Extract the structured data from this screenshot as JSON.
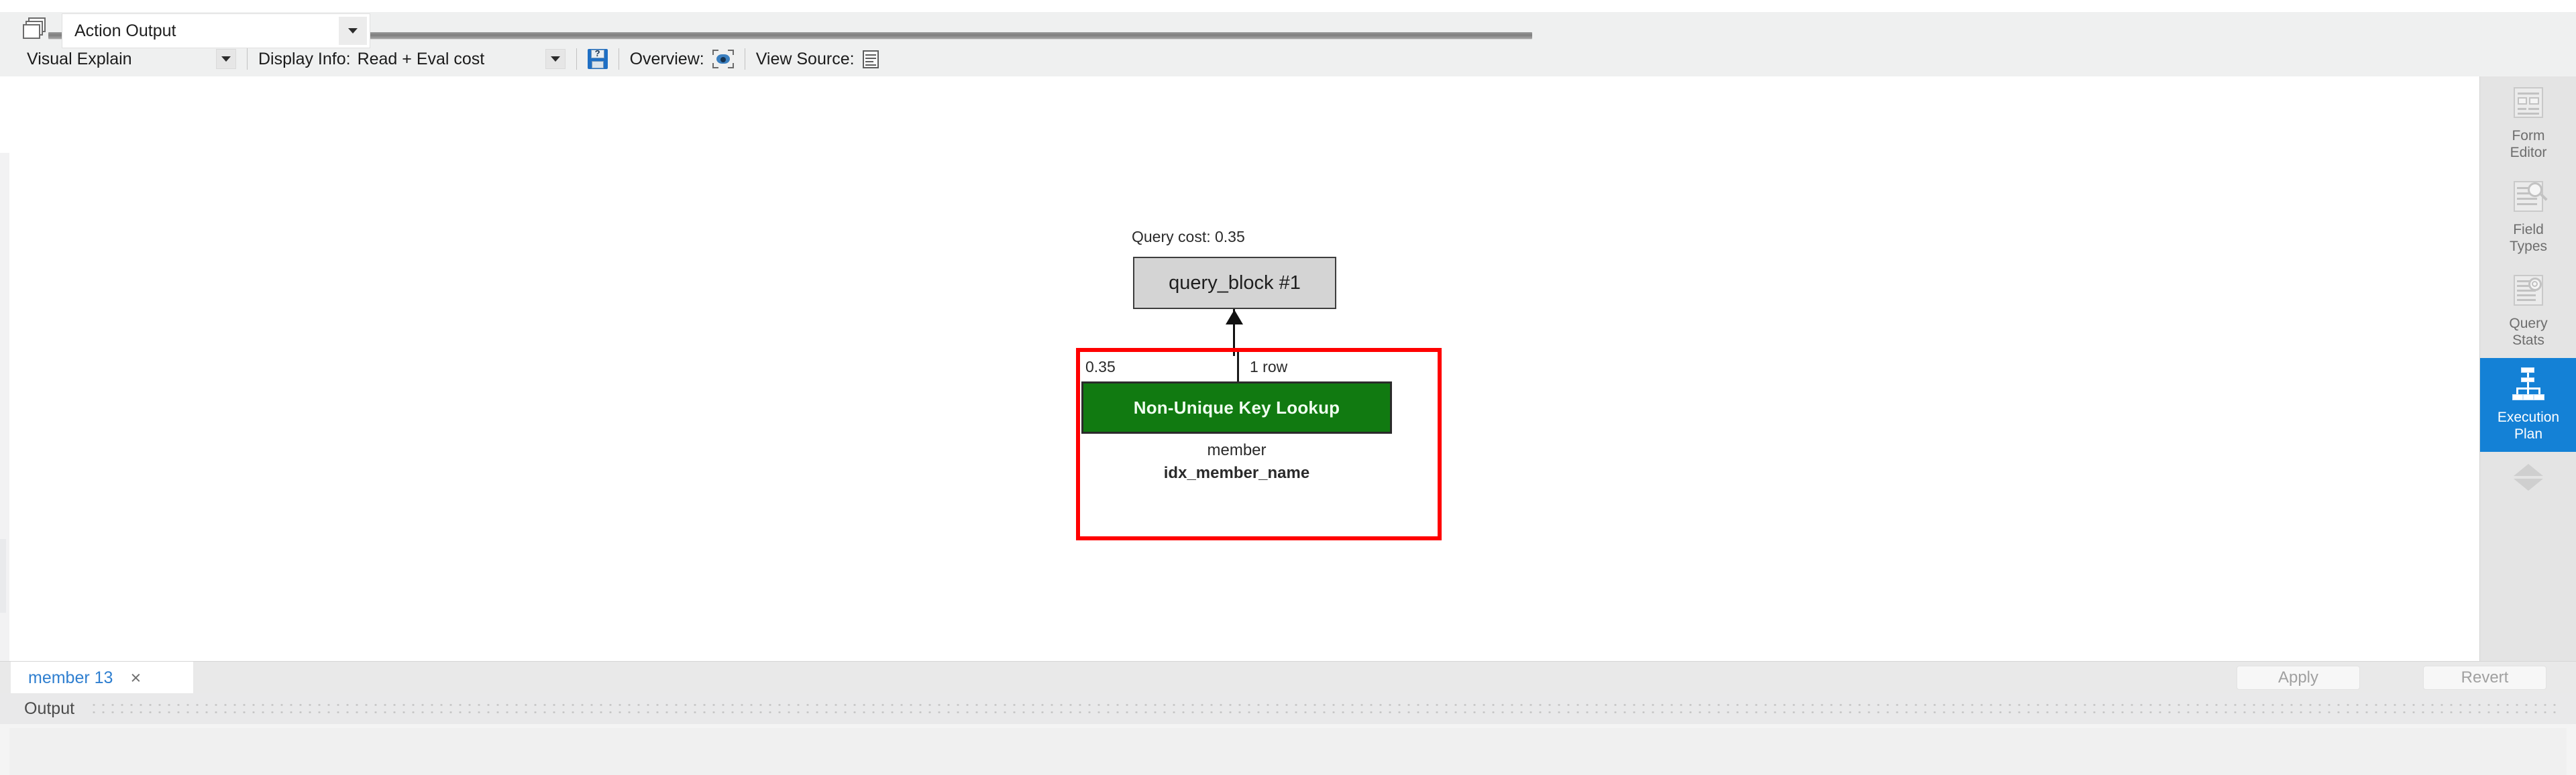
{
  "toolbar": {
    "view_mode": "Visual Explain",
    "display_info_label": "Display Info:",
    "display_info_value": "Read + Eval cost",
    "save_icon": "save-diagram-icon",
    "overview_label": "Overview:",
    "overview_icon": "overview-eye-icon",
    "view_source_label": "View Source:",
    "view_source_icon": "view-source-document-icon"
  },
  "explain": {
    "query_cost": "Query cost: 0.35",
    "query_block": "query_block #1",
    "node": {
      "cost": "0.35",
      "rows": "1 row",
      "operation": "Non-Unique Key Lookup",
      "table": "member",
      "index": "idx_member_name",
      "operation_color": "#117a11",
      "selection_color": "#ff0000",
      "selected": true
    }
  },
  "sidebar": {
    "items": [
      {
        "label": "Form\nEditor",
        "label_line1": "Form",
        "label_line2": "Editor",
        "icon": "form-editor-icon",
        "active": false
      },
      {
        "label": "Field\nTypes",
        "label_line1": "Field",
        "label_line2": "Types",
        "icon": "field-types-icon",
        "active": false
      },
      {
        "label": "Query\nStats",
        "label_line1": "Query",
        "label_line2": "Stats",
        "icon": "query-stats-icon",
        "active": false
      },
      {
        "label": "Execution\nPlan",
        "label_line1": "Execution",
        "label_line2": "Plan",
        "icon": "execution-plan-icon",
        "active": true
      }
    ],
    "active_color": "#1481d6",
    "scroll_up_icon": "chevron-up-icon",
    "scroll_down_icon": "chevron-down-icon"
  },
  "tabbar": {
    "tab_label": "member 13",
    "tab_close": "×",
    "apply_label": "Apply",
    "revert_label": "Revert"
  },
  "output": {
    "panel_title": "Output",
    "selected_source": "Action Output",
    "source_icon": "action-output-icon"
  }
}
